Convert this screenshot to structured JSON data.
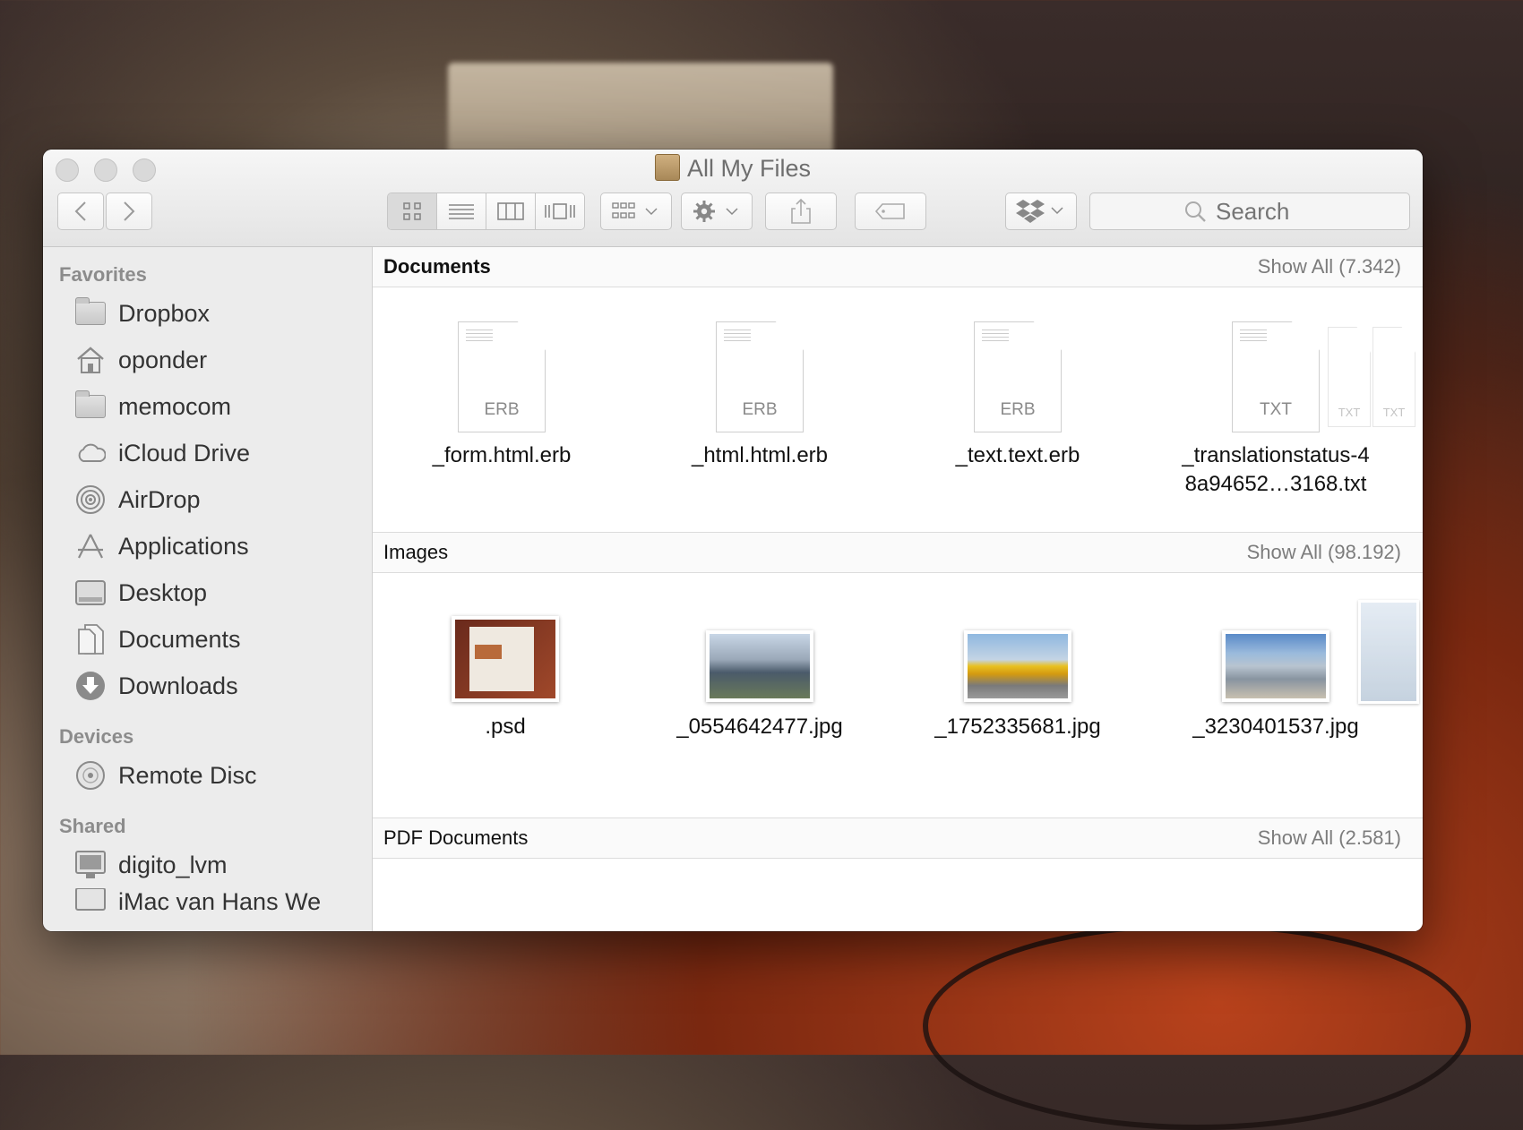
{
  "window": {
    "title": "All My Files"
  },
  "toolbar": {
    "search_placeholder": "Search",
    "back_icon": "chevron-left-icon",
    "forward_icon": "chevron-right-icon"
  },
  "sidebar": {
    "favorites_header": "Favorites",
    "favorites": [
      {
        "label": "Dropbox",
        "icon": "folder-icon"
      },
      {
        "label": "oponder",
        "icon": "home-icon"
      },
      {
        "label": "memocom",
        "icon": "folder-icon"
      },
      {
        "label": "iCloud Drive",
        "icon": "cloud-icon"
      },
      {
        "label": "AirDrop",
        "icon": "airdrop-icon"
      },
      {
        "label": "Applications",
        "icon": "applications-icon"
      },
      {
        "label": "Desktop",
        "icon": "desktop-icon"
      },
      {
        "label": "Documents",
        "icon": "documents-icon"
      },
      {
        "label": "Downloads",
        "icon": "downloads-icon"
      }
    ],
    "devices_header": "Devices",
    "devices": [
      {
        "label": "Remote Disc",
        "icon": "disc-icon"
      }
    ],
    "shared_header": "Shared",
    "shared": [
      {
        "label": "digito_lvm",
        "icon": "computer-icon"
      },
      {
        "label": "iMac van Hans We",
        "icon": "computer-icon"
      }
    ]
  },
  "sections": {
    "documents": {
      "title": "Documents",
      "show_all": "Show All (7.342)",
      "files": [
        {
          "name": "_form.html.erb",
          "ext": "ERB"
        },
        {
          "name": "_html.html.erb",
          "ext": "ERB"
        },
        {
          "name": "_text.text.erb",
          "ext": "ERB"
        },
        {
          "name": "_translationstatus-4\n8a94652…3168.txt",
          "ext": "TXT"
        }
      ],
      "ghost_ext": "TXT"
    },
    "images": {
      "title": "Images",
      "show_all": "Show All (98.192)",
      "files": [
        {
          "name": ".psd"
        },
        {
          "name": "_0554642477.jpg"
        },
        {
          "name": "_1752335681.jpg"
        },
        {
          "name": "_3230401537.jpg"
        }
      ]
    },
    "pdf": {
      "title": "PDF Documents",
      "show_all": "Show All (2.581)"
    }
  }
}
